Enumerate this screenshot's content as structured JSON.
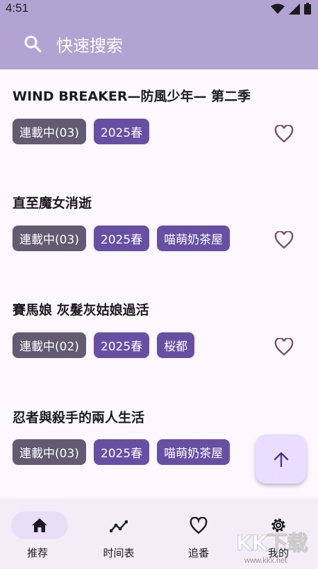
{
  "status_bar": {
    "time": "4:51"
  },
  "search": {
    "label": "快速搜索"
  },
  "items": [
    {
      "title": "WIND BREAKER—防風少年— 第二季",
      "status": "連載中(03)",
      "season": "2025春",
      "group": ""
    },
    {
      "title": "直至魔女消逝",
      "status": "連載中(03)",
      "season": "2025春",
      "group": "喵萌奶茶屋"
    },
    {
      "title": "賽馬娘 灰髮灰姑娘過活",
      "status": "連載中(02)",
      "season": "2025春",
      "group": "桜都"
    },
    {
      "title": "忍者與殺手的兩人生活",
      "status": "連載中(03)",
      "season": "2025春",
      "group": "喵萌奶茶屋"
    }
  ],
  "nav": {
    "items": [
      {
        "label": "推荐",
        "icon": "home-icon",
        "active": true
      },
      {
        "label": "时间表",
        "icon": "timeline-icon",
        "active": false
      },
      {
        "label": "追番",
        "icon": "heart-icon",
        "active": false
      },
      {
        "label": "我的",
        "icon": "gear-icon",
        "active": false
      }
    ]
  },
  "watermark": {
    "text": "KK下载",
    "url": "www.kkx.net"
  },
  "colors": {
    "app_bar": "#b3a3d2",
    "primary": "#6750a4",
    "secondary": "#625b71",
    "background": "#fdf7ff",
    "heart": "#7d5260"
  }
}
